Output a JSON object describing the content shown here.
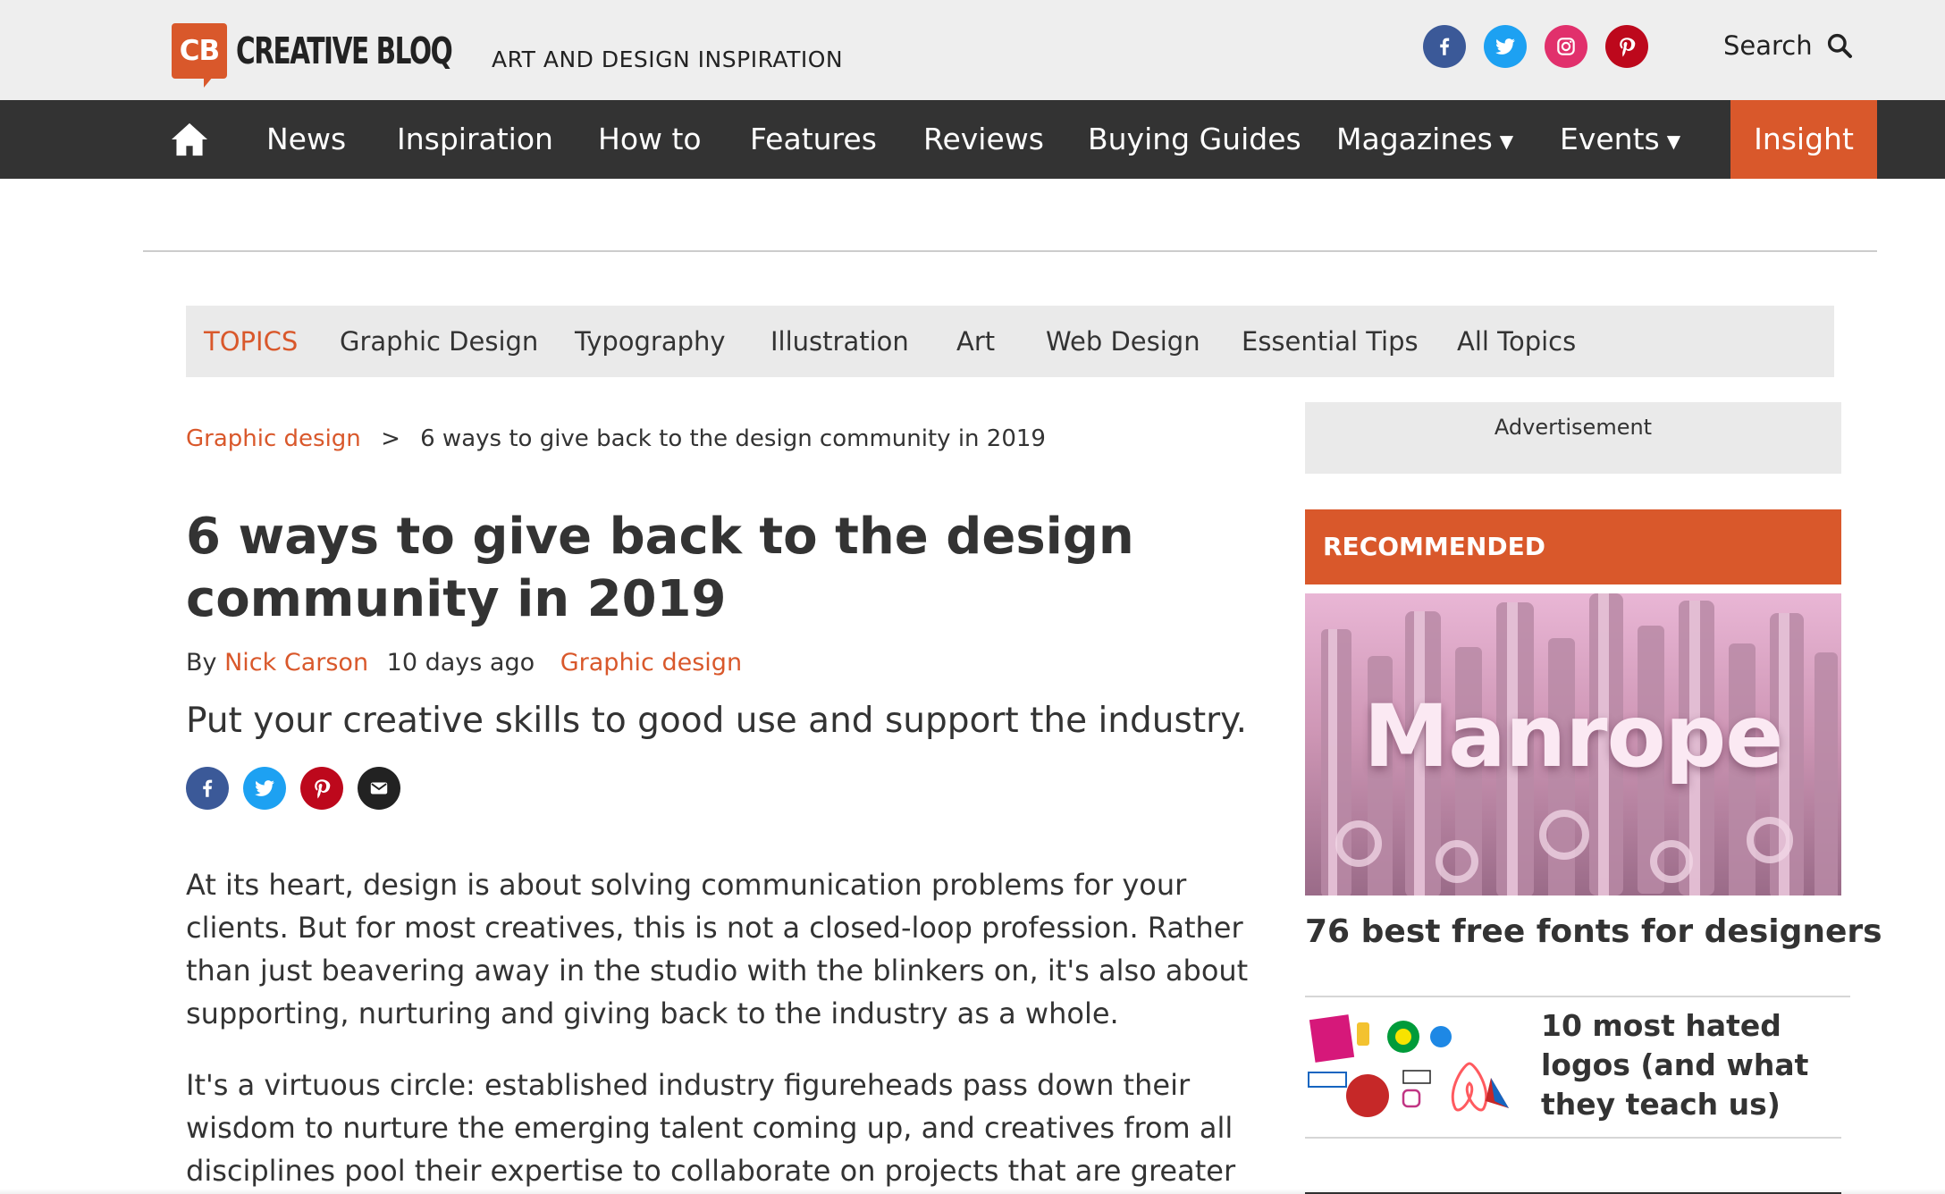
{
  "header": {
    "logo_mark": "CB",
    "logo_text": "CREATIVE BLOQ",
    "tagline": "ART AND DESIGN INSPIRATION",
    "social_icons": [
      "facebook-icon",
      "twitter-icon",
      "instagram-icon",
      "pinterest-icon"
    ],
    "search_label": "Search"
  },
  "nav": {
    "items": [
      "News",
      "Inspiration",
      "How to",
      "Features",
      "Reviews",
      "Buying Guides",
      "Magazines",
      "Events"
    ],
    "dropdown_caret": "▼",
    "insight": "Insight",
    "colors": {
      "bar": "#333333",
      "accent": "#d9582b"
    }
  },
  "topics": {
    "label": "TOPICS",
    "items": [
      "Graphic Design",
      "Typography",
      "Illustration",
      "Art",
      "Web Design",
      "Essential Tips",
      "All Topics"
    ]
  },
  "article": {
    "breadcrumb": {
      "parent": "Graphic design",
      "separator": ">",
      "current": "6 ways to give back to the design community in 2019"
    },
    "title": "6 ways to give back to the design community in 2019",
    "byline": {
      "by": "By",
      "author": "Nick Carson",
      "date": "10 days ago",
      "category": "Graphic design"
    },
    "standfirst": "Put your creative skills to good use and support the industry.",
    "share_icons": [
      "facebook-icon",
      "twitter-icon",
      "pinterest-icon",
      "email-icon"
    ],
    "paragraphs": [
      "At its heart, design is about solving communication problems for your clients. But for most creatives, this is not a closed-loop profession. Rather than just beavering away in the studio with the blinkers on, it's also about supporting, nurturing and giving back to the industry as a whole.",
      "It's a virtuous circle: established industry figureheads pass down their wisdom to nurture the emerging talent coming up, and creatives from all disciplines pool their expertise to collaborate on projects that are greater than the sum of their"
    ]
  },
  "sidebar": {
    "advertisement": "Advertisement",
    "recommended_label": "RECOMMENDED",
    "feature": {
      "image_word": "Manrope",
      "title": "76 best free fonts for designers"
    },
    "second": {
      "title": "10 most hated logos (and what they teach us)"
    }
  }
}
